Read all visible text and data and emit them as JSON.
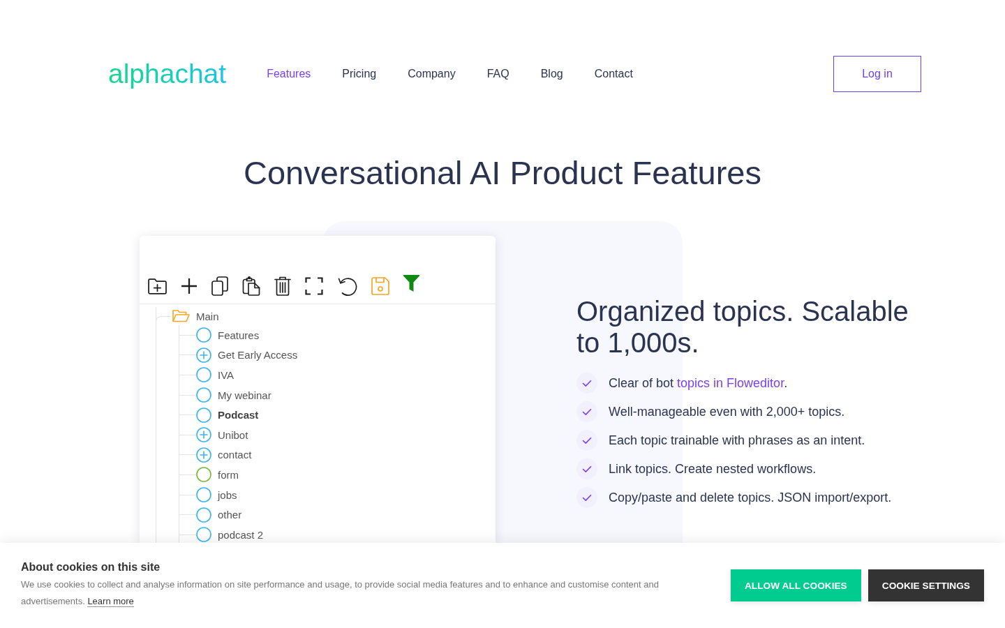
{
  "header": {
    "logo": "alphachat",
    "nav": [
      {
        "label": "Features",
        "selected": true
      },
      {
        "label": "Pricing",
        "selected": false
      },
      {
        "label": "Company",
        "selected": false
      },
      {
        "label": "FAQ",
        "selected": false
      },
      {
        "label": "Blog",
        "selected": false
      },
      {
        "label": "Contact",
        "selected": false
      }
    ],
    "login_button": "Log in"
  },
  "page_title": "Conversational AI Product Features",
  "editor": {
    "tree": {
      "label": "Main",
      "expanded": true,
      "selected": false,
      "children": [
        {
          "label": "Features",
          "kind": "topic",
          "selected": false
        },
        {
          "label": "Get Early Access",
          "kind": "group",
          "selected": false
        },
        {
          "label": "IVA",
          "kind": "topic",
          "selected": false
        },
        {
          "label": "My webinar",
          "kind": "topic",
          "selected": false
        },
        {
          "label": "Podcast",
          "kind": "topic",
          "selected": true
        },
        {
          "label": "Unibot",
          "kind": "group",
          "selected": false
        },
        {
          "label": "contact",
          "kind": "group",
          "selected": false
        },
        {
          "label": "form",
          "kind": "form",
          "selected": false
        },
        {
          "label": "jobs",
          "kind": "topic",
          "selected": false
        },
        {
          "label": "other",
          "kind": "topic",
          "selected": false
        },
        {
          "label": "podcast 2",
          "kind": "topic",
          "selected": false
        }
      ]
    }
  },
  "feature": {
    "heading": "Organized topics. Scalable to 1,000s.",
    "points": [
      {
        "segments": [
          {
            "kind": "text",
            "text": "Clear of bot "
          },
          {
            "kind": "link",
            "text": "topics in Floweditor"
          },
          {
            "kind": "text",
            "text": "."
          }
        ]
      },
      {
        "segments": [
          {
            "kind": "text",
            "text": "Well-manageable even with 2,000+ topics."
          }
        ]
      },
      {
        "segments": [
          {
            "kind": "text",
            "text": "Each topic trainable with phrases as an intent."
          }
        ]
      },
      {
        "segments": [
          {
            "kind": "text",
            "text": "Link topics. Create nested workflows."
          }
        ]
      },
      {
        "segments": [
          {
            "kind": "text",
            "text": "Copy/paste and delete topics. JSON import/export."
          }
        ]
      }
    ]
  },
  "cookie_banner": {
    "title": "About cookies on this site",
    "text": "We use cookies to collect and analyse information on site performance and usage, to provide social media features and to enhance and customise content and advertisements.",
    "link": "Learn more",
    "buttons": [
      {
        "label": "ALLOW ALL COOKIES",
        "kind": "primary"
      },
      {
        "label": "COOKIE SETTINGS",
        "kind": "secondary"
      }
    ]
  }
}
